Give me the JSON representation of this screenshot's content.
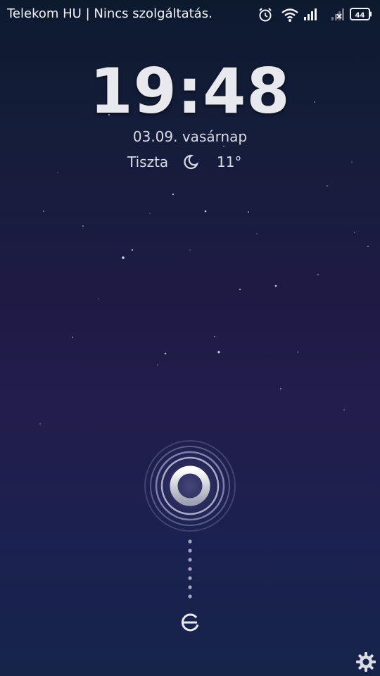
{
  "status_bar": {
    "carrier": "Telekom HU | Nincs szolgáltatás.",
    "battery_level": "44",
    "icons": [
      "alarm-clock-icon",
      "wifi-icon",
      "signal-icon",
      "signal-no-service-icon",
      "battery-icon"
    ]
  },
  "lockscreen": {
    "time": "19:48",
    "date": "03.09. vasárnap",
    "weather_condition": "Tiszta",
    "weather_icon": "moon-icon",
    "temperature": "11°"
  },
  "unlock": {
    "handle_icon": "unlock-ring-icon",
    "bottom_icon": "camera-shortcut-icon"
  },
  "settings_icon": "gear-icon",
  "colors": {
    "background_top": "#0d1a2e",
    "background_mid": "#221d4b",
    "background_bottom": "#16244a",
    "text": "#e9ecf3"
  }
}
